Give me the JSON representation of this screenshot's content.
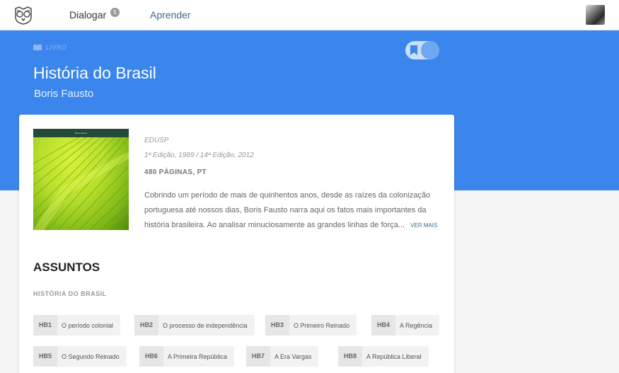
{
  "nav": {
    "dialogar_label": "Dialogar",
    "dialogar_badge": "5",
    "aprender_label": "Aprender"
  },
  "hero": {
    "type_label": "LIVRO",
    "title": "História do Brasil",
    "author": "Boris Fausto"
  },
  "book": {
    "cover_author": "Boris Fausto",
    "publisher": "EDUSP",
    "edition": "1ª Edição, 1989 / 14ª Edição, 2012",
    "pages": "480 PÁGINAS, PT",
    "description": "Cobrindo um período de mais de quinhentos anos, desde as raízes da colonização portuguesa até nossos dias, Boris Fausto narra aqui os fatos mais importantes da história brasileira. Ao analisar minuciosamente as grandes linhas de força...",
    "ver_mais": "VER MAIS"
  },
  "subjects": {
    "heading": "ASSUNTOS",
    "group_label": "HISTÓRIA DO BRASIL",
    "chips": [
      {
        "code": "HB1",
        "name": "O período colonial"
      },
      {
        "code": "HB2",
        "name": "O processo de independência"
      },
      {
        "code": "HB3",
        "name": "O Primeiro Reinado"
      },
      {
        "code": "HB4",
        "name": "A Regência"
      },
      {
        "code": "HB5",
        "name": "O Segundo Reinado"
      },
      {
        "code": "HB6",
        "name": "A Primeira República"
      },
      {
        "code": "HB7",
        "name": "A Era Vargas"
      },
      {
        "code": "HB8",
        "name": "A República Liberal"
      }
    ]
  },
  "colors": {
    "hero_blue": "#3a86ed",
    "link": "#3a6a8a"
  }
}
